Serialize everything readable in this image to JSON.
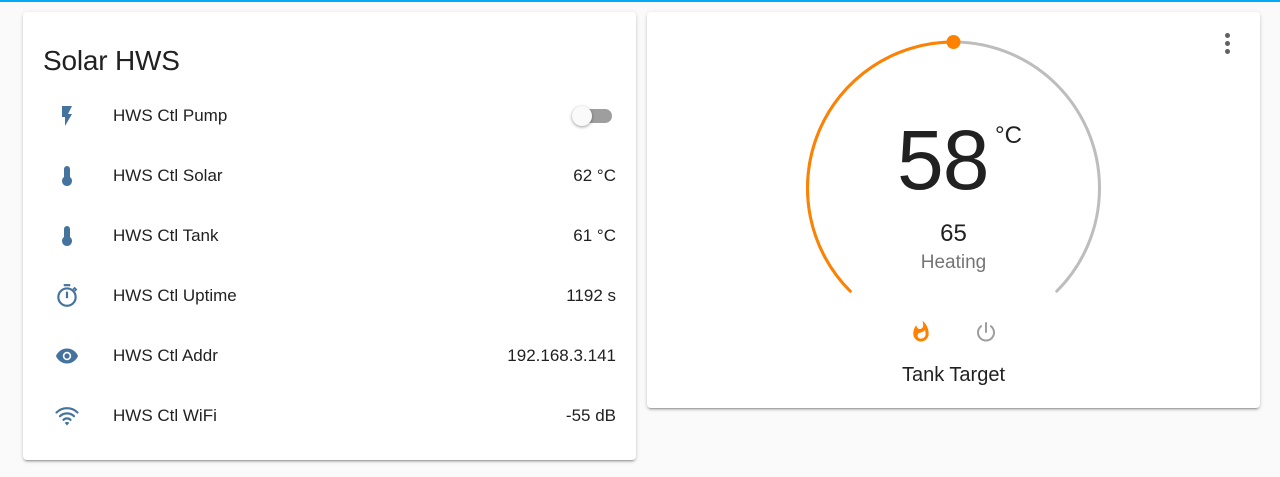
{
  "colors": {
    "accent": "#03a9f4",
    "icon": "#44739e",
    "heat": "#ff8100",
    "track": "#bdbdbd",
    "muted": "#9e9e9e"
  },
  "entities_card": {
    "title": "Solar HWS",
    "rows": [
      {
        "icon": "flash-icon",
        "label": "HWS Ctl Pump",
        "value": "",
        "toggle_on": false
      },
      {
        "icon": "thermometer-icon",
        "label": "HWS Ctl Solar",
        "value": "62 °C"
      },
      {
        "icon": "thermometer-icon",
        "label": "HWS Ctl Tank",
        "value": "61 °C"
      },
      {
        "icon": "timer-icon",
        "label": "HWS Ctl Uptime",
        "value": "1192 s"
      },
      {
        "icon": "eye-icon",
        "label": "HWS Ctl Addr",
        "value": "192.168.3.141"
      },
      {
        "icon": "wifi-icon",
        "label": "HWS Ctl WiFi",
        "value": "-55 dB"
      }
    ]
  },
  "thermostat_card": {
    "current_temp": "58",
    "unit": "°C",
    "target_temp": "65",
    "hvac_action": "Heating",
    "name": "Tank Target",
    "setpoint_fraction": 0.5,
    "modes": [
      {
        "name": "heat",
        "icon": "fire-icon",
        "active": true
      },
      {
        "name": "off",
        "icon": "power-icon",
        "active": false
      }
    ]
  }
}
